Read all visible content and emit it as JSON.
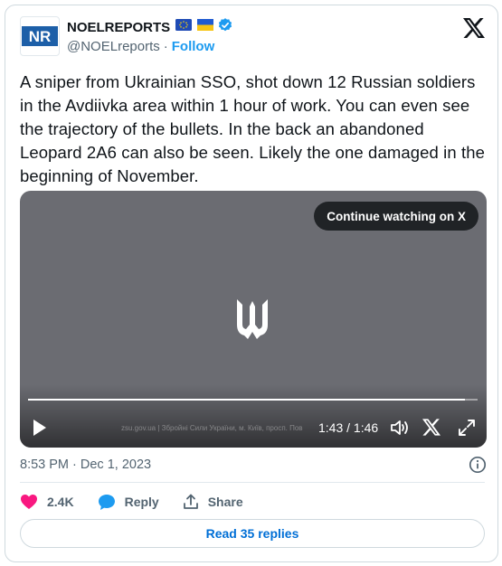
{
  "author": {
    "name": "NOELREPORTS",
    "handle": "@NOELreports",
    "separator": "·",
    "follow_label": "Follow",
    "avatar_icon": "nr-logo-icon",
    "badges": [
      "eu-flag-icon",
      "ukraine-flag-icon",
      "verified-badge-icon"
    ]
  },
  "tweet": {
    "text": "A sniper from Ukrainian SSO, shot down 12 Russian soldiers in the Avdiivka area within 1 hour of work. You can even see the trajectory of the bullets. In the back an abandoned Leopard 2A6 can also be seen. Likely the one damaged in the beginning of November."
  },
  "video": {
    "continue_label": "Continue watching on X",
    "time_display": "1:43 / 1:46",
    "progress": 0.972,
    "watermark": "zsu.gov.ua | Збройні Сили України, м. Київ, просп. Пов",
    "icons": [
      "play-icon",
      "volume-icon",
      "x-logo-icon",
      "fullscreen-icon",
      "tryzub-icon"
    ]
  },
  "meta": {
    "timestamp": "8:53 PM · Dec 1, 2023"
  },
  "actions": {
    "likes": "2.4K",
    "reply_label": "Reply",
    "share_label": "Share"
  },
  "replies": {
    "label": "Read 35 replies"
  },
  "colors": {
    "accent": "#1d9bf0",
    "link": "#006fd6",
    "like": "#f91880",
    "muted": "#536471",
    "video_bg": "#6b6c72"
  }
}
